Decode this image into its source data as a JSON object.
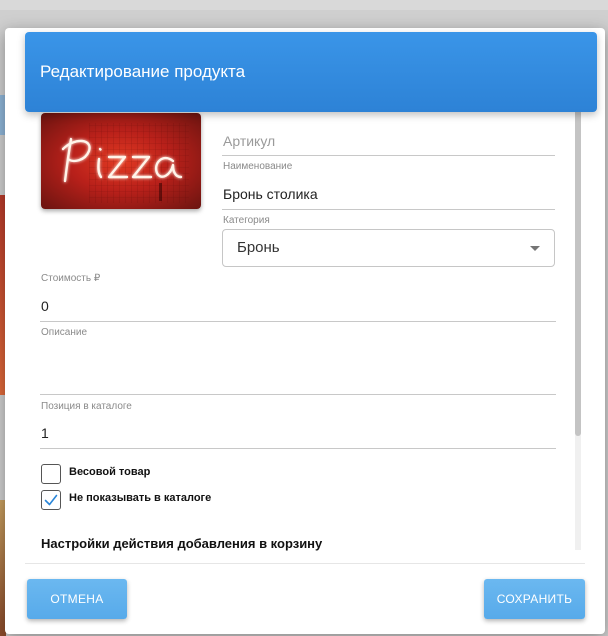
{
  "dialog": {
    "title": "Редактирование продукта"
  },
  "product_image": {
    "description_icon": "pizza-neon-image",
    "neon_text": "Pizza"
  },
  "form": {
    "article": {
      "placeholder": "Артикул",
      "value": ""
    },
    "name": {
      "label": "Наименование",
      "value": "Бронь столика"
    },
    "category": {
      "label": "Категория",
      "value": "Бронь"
    },
    "price": {
      "label": "Стоимость ₽",
      "value": "0"
    },
    "description": {
      "label": "Описание",
      "value": ""
    },
    "catalog_position": {
      "label": "Позиция в каталоге",
      "value": "1"
    },
    "weight_item": {
      "label": "Весовой товар",
      "checked": false
    },
    "hide_in_catalog": {
      "label": "Не показывать в каталоге",
      "checked": true
    },
    "section_title": "Настройки действия добавления в корзину"
  },
  "buttons": {
    "cancel": "ОТМЕНА",
    "save": "СОХРАНИТЬ"
  },
  "colors": {
    "header": "#3490e3",
    "button": "#5eb0ec",
    "checkmark": "#2a86d8"
  }
}
